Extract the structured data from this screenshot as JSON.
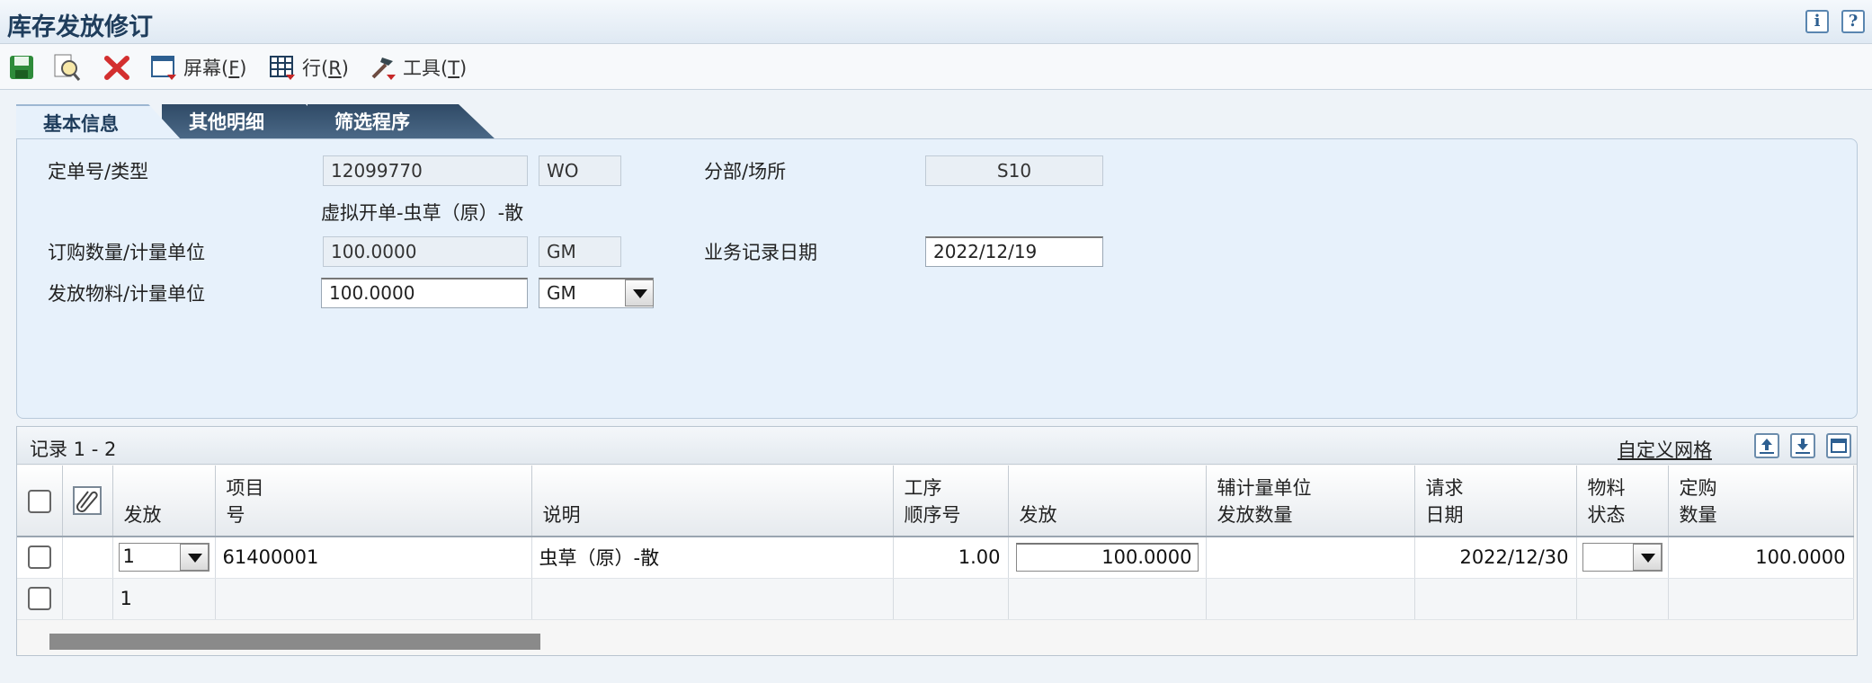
{
  "window": {
    "title": "库存发放修订",
    "info_icon": "info-icon",
    "help_icon": "help-icon"
  },
  "toolbar": {
    "screen_label": "屏幕(",
    "screen_key": "F",
    "row_label": "行(",
    "row_key": "R",
    "tools_label": "工具(",
    "tools_key": "T",
    "close_paren": ")"
  },
  "tabs": [
    "基本信息",
    "其他明细",
    "筛选程序"
  ],
  "form": {
    "order_label": "定单号/类型",
    "order_no": "12099770",
    "order_type": "WO",
    "branch_label": "分部/场所",
    "branch_value": "S10",
    "description": "虚拟开单-虫草（原）-散",
    "order_qty_label": "订购数量/计量单位",
    "order_qty": "100.0000",
    "order_uom": "GM",
    "trans_date_label": "业务记录日期",
    "trans_date": "2022/12/19",
    "issue_label": "发放物料/计量单位",
    "issue_qty": "100.0000",
    "issue_uom": "GM"
  },
  "grid": {
    "records": "记录 1 - 2",
    "customize": "自定义网格",
    "columns": {
      "issue": "发放",
      "item_1": "项目",
      "item_2": "号",
      "desc": "说明",
      "op_1": "工序",
      "op_2": "顺序号",
      "issue_qty": "发放",
      "sec_1": "辅计量单位",
      "sec_2": "发放数量",
      "req_1": "请求",
      "req_2": "日期",
      "stat_1": "物料",
      "stat_2": "状态",
      "ord_1": "定购",
      "ord_2": "数量"
    },
    "rows": [
      {
        "issue": "1",
        "item": "61400001",
        "desc": "虫草（原）-散",
        "op_seq": "1.00",
        "issue_qty": "100.0000",
        "req_date": "2022/12/30",
        "order_qty": "100.0000"
      },
      {
        "issue": "1"
      }
    ]
  }
}
